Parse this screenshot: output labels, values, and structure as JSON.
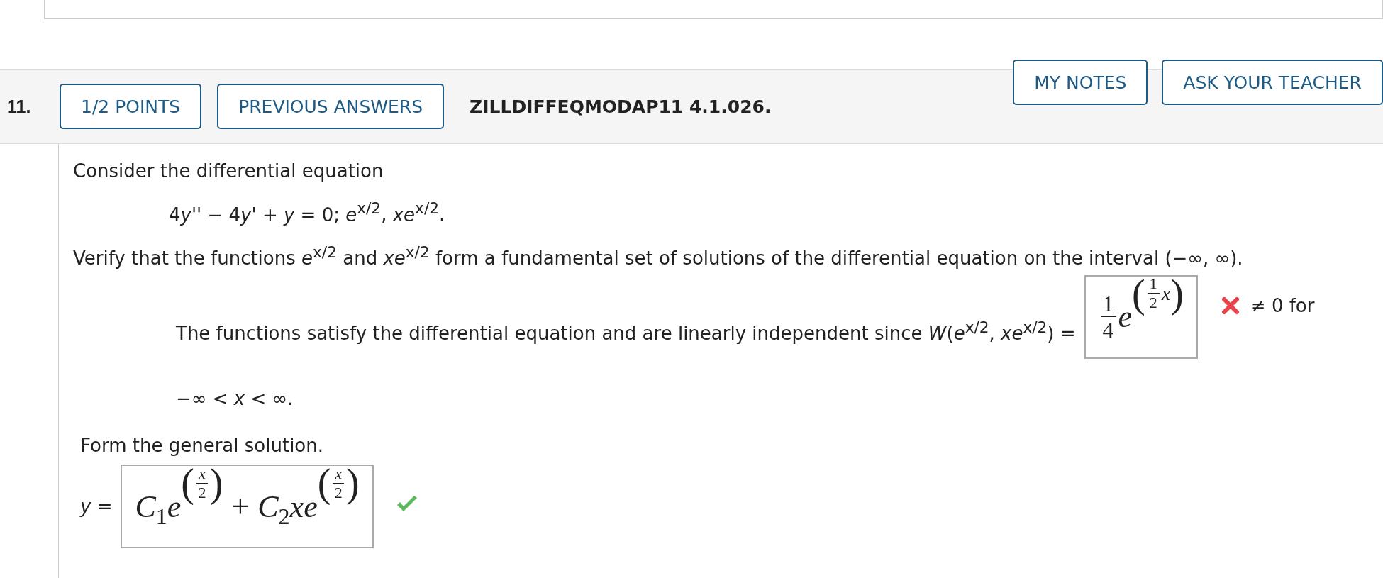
{
  "question": {
    "number": "11.",
    "points": "1/2 POINTS",
    "previous_answers": "PREVIOUS ANSWERS",
    "problem_id": "ZILLDIFFEQMODAP11 4.1.026.",
    "buttons": [
      "MY NOTES",
      "ASK YOUR TEACHER"
    ]
  },
  "intro": "Consider the differential equation",
  "equation": [
    {
      "text": "4",
      "italic": false
    },
    {
      "text": "y",
      "italic": true
    },
    {
      "text": "'' − 4",
      "italic": false
    },
    {
      "text": "y",
      "italic": true
    },
    {
      "text": "' + ",
      "italic": false
    },
    {
      "text": "y",
      "italic": true
    },
    {
      "text": " = 0;  ",
      "italic": false
    },
    {
      "text": "e",
      "italic": true
    },
    {
      "text": "$^{x/2}$, ",
      "italic": false
    },
    {
      "text": "xe",
      "italic": true
    },
    {
      "text": "$^{x/2}$.",
      "italic": false
    }
  ],
  "verify": "Verify that the functions *e*$^{x/2}$ and *xe*$^{x/2}$ form a fundamental set of solutions of the differential equation on the interval (−∞, ∞).",
  "wronskian": {
    "statement": "The functions satisfy the differential equation and are linearly independent since *W*(*e*$^{x/2}$, *xe*$^{x/2}$) =",
    "answer": {
      "coef_num": "1",
      "coef_den": "4",
      "base": "e",
      "open": "(",
      "exp_num": "1",
      "exp_den": "2",
      "exp_tail": "x",
      "close": ")"
    },
    "correct": false,
    "after": "≠ 0 for",
    "interval": "−∞ < *x* < ∞."
  },
  "general": {
    "prompt": "Form the general solution.",
    "lhs": "*y* =",
    "terms": [
      {
        "coef": "C",
        "sub": "1",
        "factor": "e",
        "open": "(",
        "exp_num": "x",
        "exp_den": "2",
        "close": ")"
      },
      {
        "operator": "+",
        "coef": "C",
        "sub": "2",
        "factor": "xe",
        "open": "(",
        "exp_num": "x",
        "exp_den": "2",
        "close": ")"
      }
    ],
    "correct": true
  }
}
